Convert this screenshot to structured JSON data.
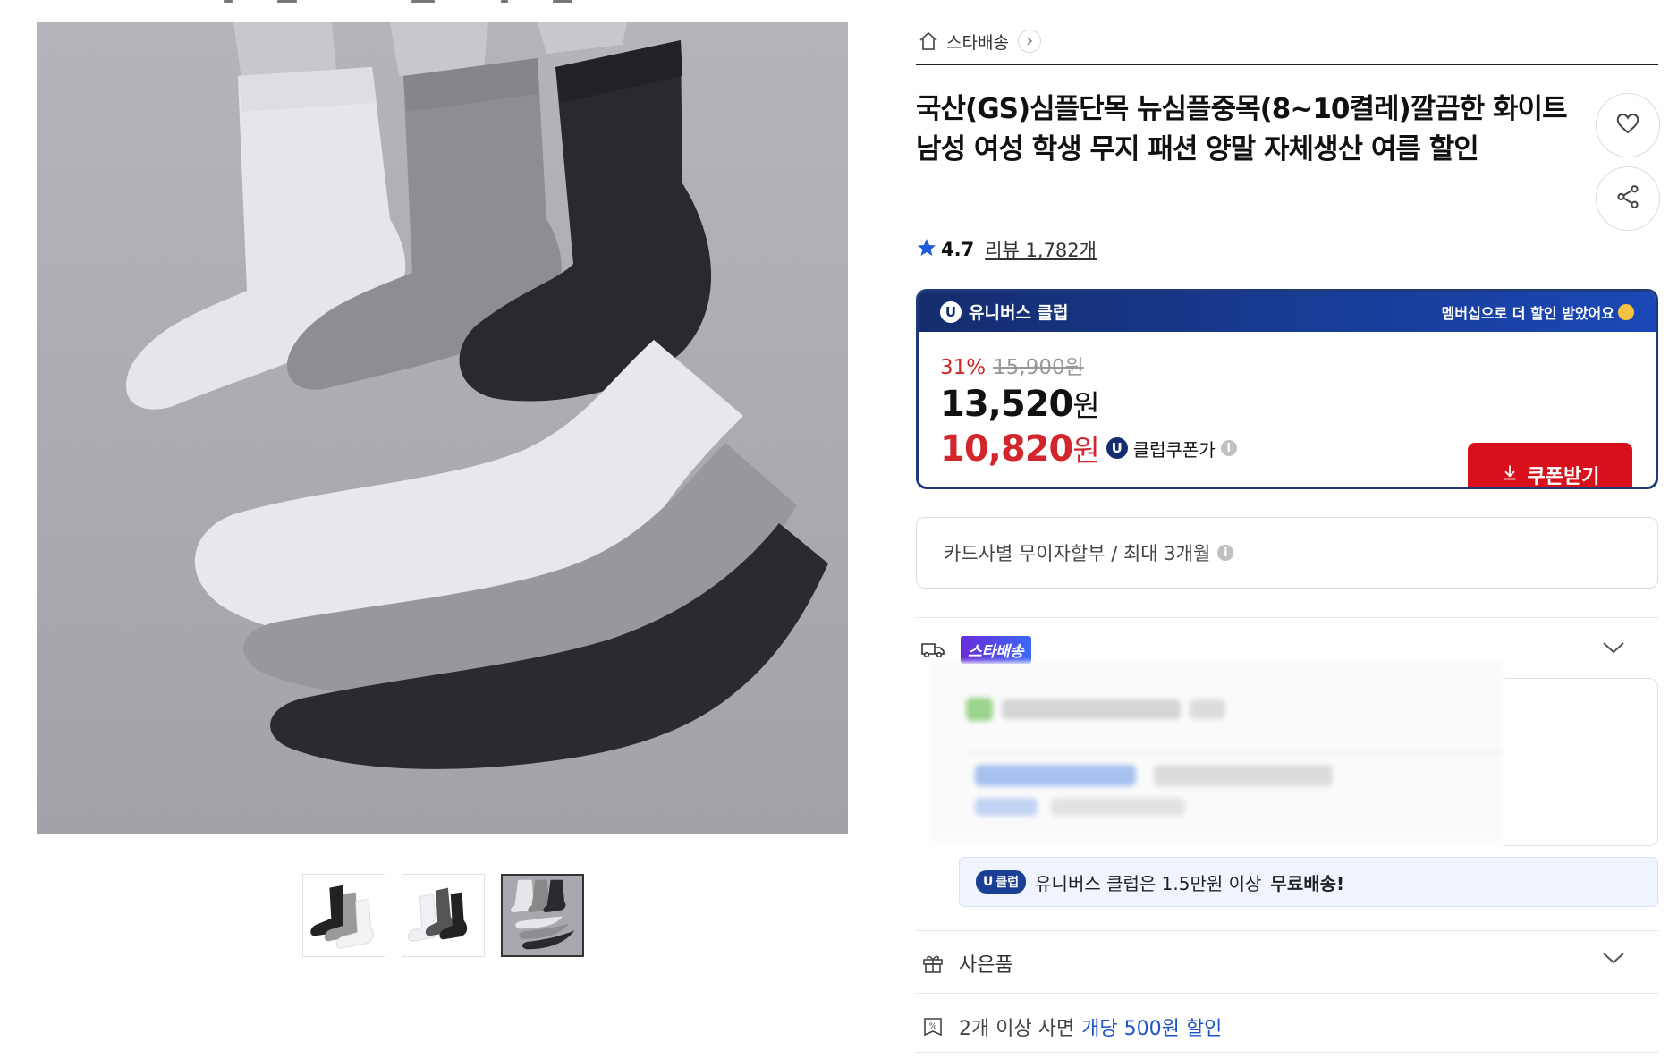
{
  "breadcrumb": {
    "label": "스타배송"
  },
  "product": {
    "title": "국산(GS)심플단목 뉴심플중목(8~10켤레)깔끔한 화이트 남성 여성 학생 무지 패션 양말 자체생산 여름 할인",
    "rating": "4.7",
    "review_label": "리뷰",
    "review_count": "1,782개"
  },
  "price_box": {
    "club_name": "유니버스 클럽",
    "club_badge": "U",
    "member_message": "멤버십으로 더 할인 받았어요",
    "discount_rate": "31%",
    "original_price": "15,900원",
    "sale_price": "13,520",
    "sale_unit": "원",
    "coupon_price": "10,820",
    "coupon_unit": "원",
    "coupon_label": "클럽쿠폰가",
    "coupon_button": "쿠폰받기"
  },
  "installment": {
    "text": "카드사별 무이자할부 / 최대 3개월"
  },
  "delivery": {
    "badge": "스타배송"
  },
  "free_shipping": {
    "pill_u": "U",
    "pill_text": "클럽",
    "text": "유니버스 클럽은 1.5만원 이상",
    "bold": "무료배송!"
  },
  "gift": {
    "label": "사은품"
  },
  "multi_buy": {
    "text": "2개 이상 사면",
    "highlight": "개당 500원 할인"
  },
  "icons": {
    "home": "home-icon",
    "chevron": "chevron-right-icon",
    "wish": "heart-icon",
    "share": "share-icon",
    "star": "star-icon",
    "truck": "truck-icon",
    "gift": "gift-icon",
    "coupon": "coupon-icon",
    "download": "download-icon",
    "info": "info-icon"
  },
  "colors": {
    "accent_red": "#d8101c",
    "club_navy": "#1e3a78",
    "link_blue": "#1e54c7",
    "star_blue": "#1f5bd6"
  }
}
